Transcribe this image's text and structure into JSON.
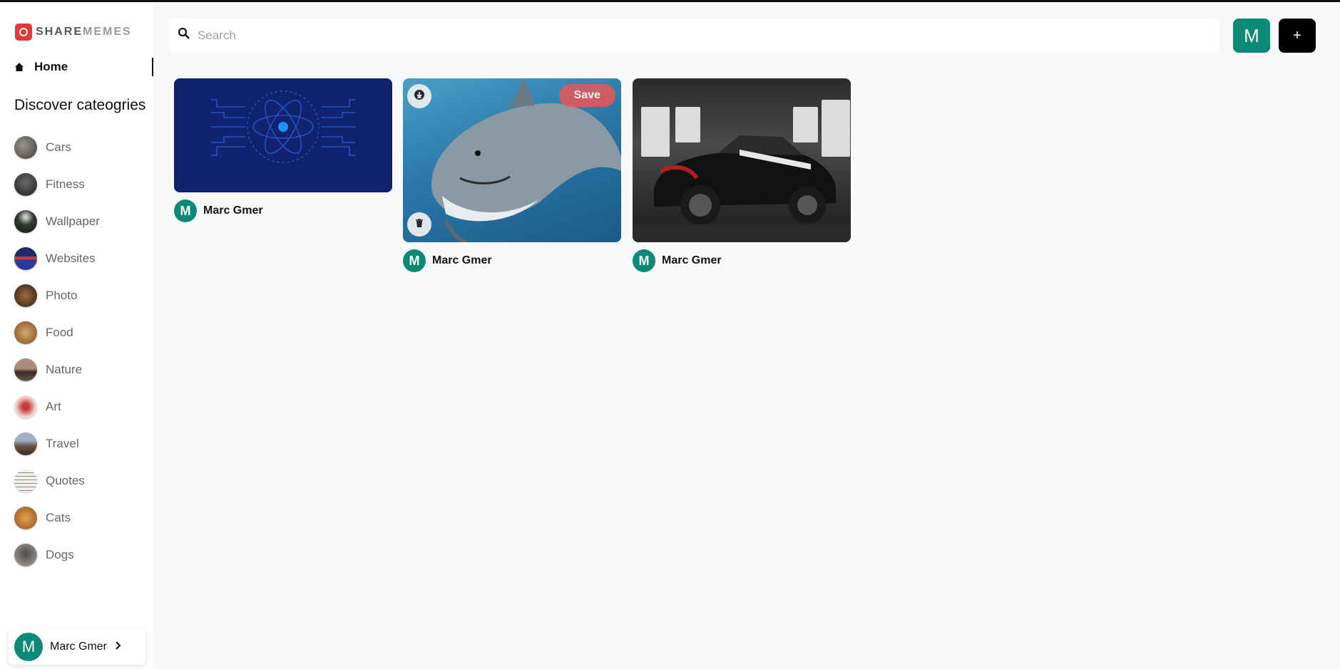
{
  "app": {
    "logo_share": "SHARE",
    "logo_memes": "MEMES"
  },
  "sidebar": {
    "home_label": "Home",
    "discover_title": "Discover cateogries",
    "categories": [
      {
        "label": "Cars",
        "color": "#6d6a66"
      },
      {
        "label": "Fitness",
        "color": "#3b3b3b"
      },
      {
        "label": "Wallpaper",
        "color": "#2e3a30"
      },
      {
        "label": "Websites",
        "color": "#2a3a7a"
      },
      {
        "label": "Photo",
        "color": "#5a3a2a"
      },
      {
        "label": "Food",
        "color": "#a0784a"
      },
      {
        "label": "Nature",
        "color": "#8a6a5a"
      },
      {
        "label": "Art",
        "color": "#d88a7a"
      },
      {
        "label": "Travel",
        "color": "#7a6a60"
      },
      {
        "label": "Quotes",
        "color": "#e8e6df"
      },
      {
        "label": "Cats",
        "color": "#c98a3a"
      },
      {
        "label": "Dogs",
        "color": "#6a6a70"
      }
    ],
    "user": {
      "initial": "M",
      "name": "Marc Gmer"
    }
  },
  "topbar": {
    "search_placeholder": "Search",
    "avatar_initial": "M",
    "add_label": "+"
  },
  "pins": [
    {
      "user_initial": "M",
      "user_name": "Marc Gmer",
      "image": "react-logo"
    },
    {
      "user_initial": "M",
      "user_name": "Marc Gmer",
      "image": "shark",
      "save_label": "Save"
    },
    {
      "user_initial": "M",
      "user_name": "Marc Gmer",
      "image": "sports-car"
    }
  ],
  "colors": {
    "accent": "#0c8a78",
    "save": "#e05a5a",
    "brand": "#e53935"
  },
  "icons": [
    "logo-icon",
    "home-icon",
    "search-icon",
    "chevron-right-icon",
    "download-icon",
    "trash-icon",
    "plus-icon"
  ]
}
